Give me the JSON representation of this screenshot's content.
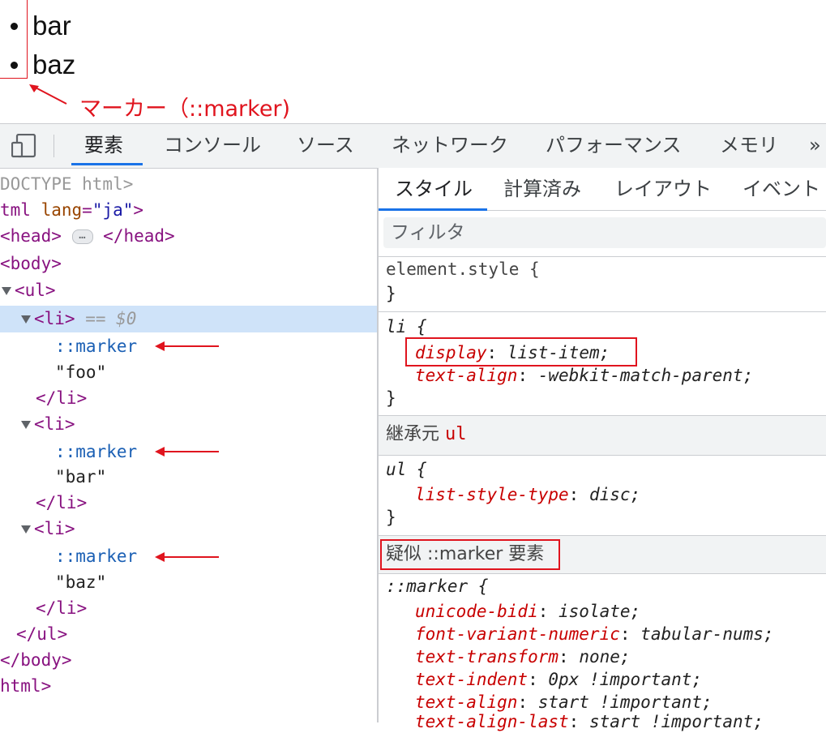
{
  "preview": {
    "items": [
      "bar",
      "baz"
    ],
    "annotation": "マーカー（::marker)"
  },
  "devtools": {
    "tabs": [
      "要素",
      "コンソール",
      "ソース",
      "ネットワーク",
      "パフォーマンス",
      "メモリ",
      "»"
    ]
  },
  "elements": {
    "doctype": "DOCTYPE html>",
    "html_open_tag": "tml",
    "html_attr_name": "lang",
    "html_attr_value": "\"ja\"",
    "head_open": "<head>",
    "head_close": "</head>",
    "body_open": "<body>",
    "ul_open": "<ul>",
    "li_open": "<li>",
    "selected_suffix": "== $0",
    "marker": "::marker",
    "text_nodes": [
      "\"foo\"",
      "\"bar\"",
      "\"baz\""
    ],
    "li_close": "</li>",
    "ul_close": "</ul>",
    "body_close": "</body>",
    "html_close": "html>"
  },
  "styles": {
    "tabs": [
      "スタイル",
      "計算済み",
      "レイアウト",
      "イベント"
    ],
    "filter_placeholder": "フィルタ",
    "element_style": "element.style {",
    "close_brace": "}",
    "li_selector": "li {",
    "li_props": [
      {
        "name": "display",
        "value": "list-item;"
      },
      {
        "name": "text-align",
        "value": "-webkit-match-parent;"
      }
    ],
    "inherited_label": "継承元",
    "inherited_from": "ul",
    "ul_selector": "ul {",
    "ul_props": [
      {
        "name": "list-style-type",
        "value": "disc;"
      }
    ],
    "pseudo_header": "疑似 ::marker 要素",
    "marker_selector": "::marker {",
    "marker_props": [
      {
        "name": "unicode-bidi",
        "value": "isolate;"
      },
      {
        "name": "font-variant-numeric",
        "value": "tabular-nums;"
      },
      {
        "name": "text-transform",
        "value": "none;"
      },
      {
        "name": "text-indent",
        "value": "0px !important;"
      },
      {
        "name": "text-align",
        "value": "start !important;"
      },
      {
        "name": "text-align-last",
        "value": "start !important;"
      }
    ]
  },
  "colors": {
    "annotation_red": "#e0141e",
    "tab_active_blue": "#1a73e8",
    "tag_purple": "#881280",
    "prop_red": "#c80000",
    "selected_row": "#cfe3f9"
  }
}
